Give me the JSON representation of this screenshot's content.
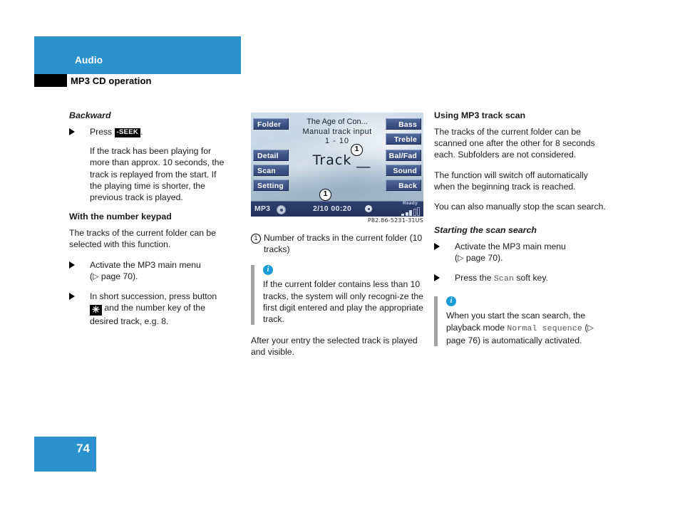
{
  "header": {
    "chapter": "Audio",
    "section": "MP3 CD operation"
  },
  "footer": {
    "page_number": "74"
  },
  "colors": {
    "brand_blue": "#2b92ce",
    "info_blue": "#1b9cd9",
    "note_rule_grey": "#a3a3a3",
    "softkey_blue": "#3f5386",
    "status_bar_blue": "#2e3f6e"
  },
  "left_column": {
    "heading_backward": "Backward",
    "press_label": "Press",
    "seek_key_label": "-SEEK",
    "press_period": ".",
    "backward_body": "If the track has been playing for more than approx. 10 seconds, the track is replayed from the start. If the playing time is shorter, the previous track is played.",
    "heading_keypad": "With the number keypad",
    "keypad_body": "The tracks of the current folder can be selected with this function.",
    "step1_line1": "Activate the MP3 main menu",
    "step1_ref_open": "(",
    "step1_ref_arrow": "▷",
    "step1_ref_text": " page 70).",
    "step2_pre": "In short succession, press button",
    "asterisk_key_label": "✳",
    "step2_post": "and the number key of the desired track, e.g. 8."
  },
  "display": {
    "title_line1": "The Age of Con...",
    "title_line2": "Manual track input",
    "title_line3": "1 - 10",
    "track_label": "Track",
    "track_blanks": "__",
    "softkeys_left": [
      "Folder",
      "Detail",
      "Scan",
      "Setting"
    ],
    "softkeys_right": [
      "Bass",
      "Treble",
      "Bal/Fad",
      "Sound",
      "Back"
    ],
    "callout_top": "1",
    "callout_bottom": "1",
    "status_source": "MP3",
    "status_counts": "2/10  00:20",
    "status_ready": "Ready",
    "figure_code": "P82.86-5231-31US"
  },
  "mid_column": {
    "legend_number": "1",
    "legend_text": "Number of tracks in the current folder (10 tracks)",
    "note_icon": "i",
    "note_text": "If the current folder contains less than 10 tracks, the system will only recogni-ze the first digit entered and play the appropriate track.",
    "after_entry_text": "After your entry the selected track is played and visible."
  },
  "right_column": {
    "heading_scan": "Using MP3 track scan",
    "para1": "The tracks of the current folder can be scanned one after the other for 8 seconds each. Subfolders are not considered.",
    "para2": "The function will switch off automatically when the beginning track is reached.",
    "para3": "You can also manually stop the scan search.",
    "heading_starting": "Starting the scan search",
    "step1_line1": "Activate the MP3 main menu",
    "step1_ref_open": "(",
    "step1_ref_arrow": "▷",
    "step1_ref_text": " page 70).",
    "step2_pre": "Press the",
    "step2_key": "Scan",
    "step2_post": "soft key.",
    "note_icon": "i",
    "note_line1": "When you start the scan search, the",
    "note_line2_pre": "playback mode",
    "note_line2_key": "Normal sequence",
    "note_line3_open": "(",
    "note_line3_arrow": "▷",
    "note_line3_text": " page 76) is automatically activated."
  }
}
